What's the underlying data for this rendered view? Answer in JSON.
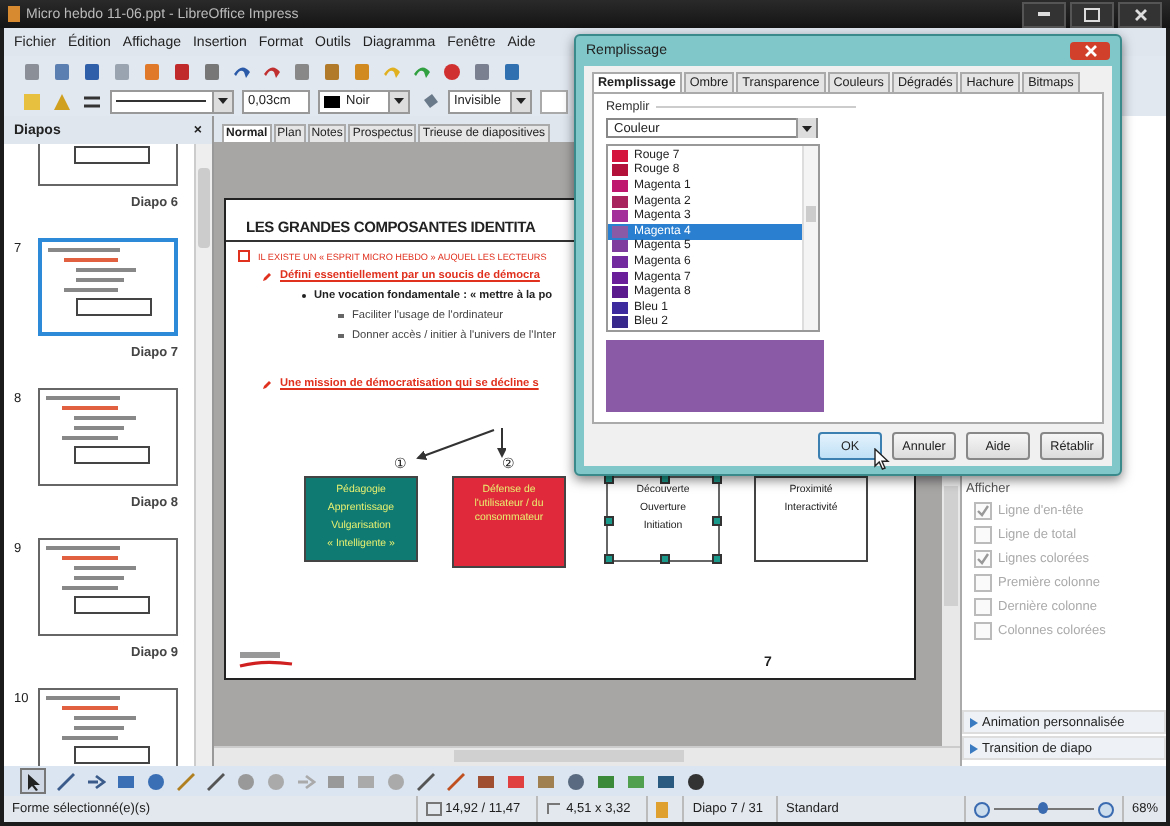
{
  "window": {
    "title": "Micro hebdo 11-06.ppt - LibreOffice Impress"
  },
  "menu": [
    "Fichier",
    "Édition",
    "Affichage",
    "Insertion",
    "Format",
    "Outils",
    "Diagramma",
    "Fenêtre",
    "Aide"
  ],
  "line_toolbar": {
    "line_width": "0,03cm",
    "line_color": "Noir",
    "area_style": "Invisible"
  },
  "slides_panel": {
    "title": "Diapos",
    "close": "×",
    "slides": [
      {
        "label": "Diapo 6",
        "selected": false
      },
      {
        "number": "7",
        "label": "Diapo 7",
        "selected": true
      },
      {
        "number": "8",
        "label": "Diapo 8",
        "selected": false
      },
      {
        "number": "9",
        "label": "Diapo 9",
        "selected": false
      },
      {
        "number": "10",
        "selected": false
      }
    ]
  },
  "view_tabs": [
    {
      "label": "Normal",
      "selected": true
    },
    {
      "label": "Plan",
      "selected": false
    },
    {
      "label": "Notes",
      "selected": false
    },
    {
      "label": "Prospectus",
      "selected": false
    },
    {
      "label": "Trieuse de diapositives",
      "selected": false
    }
  ],
  "slide": {
    "title": "LES GRANDES COMPOSANTES IDENTITA",
    "lines": [
      {
        "kind": "heading",
        "text": "IL EXISTE UN « ESPRIT MICRO HEBDO » AUQUEL LES LECTEURS"
      },
      {
        "kind": "link",
        "text": "Défini essentiellement par un soucis de démocra"
      },
      {
        "kind": "bullet",
        "text": "Une vocation fondamentale : « mettre à la po"
      },
      {
        "kind": "sub",
        "text": "Faciliter l'usage de l'ordinateur"
      },
      {
        "kind": "sub",
        "text": "Donner accès / initier à l'univers de l'Inter"
      },
      {
        "kind": "link",
        "text": "Une mission de démocratisation qui se décline s"
      }
    ],
    "markers": [
      "①",
      "②"
    ],
    "boxes": [
      {
        "lines": [
          "Pédagogie",
          "Apprentissage",
          "Vulgarisation",
          "« Intelligente »"
        ],
        "color": "#0f7a72",
        "selected": false
      },
      {
        "lines": [
          "Défense de",
          "l'utilisateur / du",
          "consommateur"
        ],
        "color": "#e02a3c",
        "selected": false
      },
      {
        "lines": [
          "Découverte",
          "Ouverture",
          "Initiation"
        ],
        "color": "#ffffff",
        "selected": true
      },
      {
        "lines": [
          "Proximité",
          "Interactivité"
        ],
        "color": "#ffffff",
        "selected": false
      }
    ],
    "page_number": "7"
  },
  "task_panel": {
    "section": "Afficher",
    "options": [
      {
        "label": "Ligne d'en-tête",
        "checked": true,
        "disabled": true
      },
      {
        "label": "Ligne de total",
        "checked": false,
        "disabled": true
      },
      {
        "label": "Lignes colorées",
        "checked": true,
        "disabled": true
      },
      {
        "label": "Première colonne",
        "checked": false,
        "disabled": true
      },
      {
        "label": "Dernière colonne",
        "checked": false,
        "disabled": true
      },
      {
        "label": "Colonnes colorées",
        "checked": false,
        "disabled": true
      }
    ],
    "sections": [
      "Animation personnalisée",
      "Transition de diapo"
    ]
  },
  "dialog": {
    "title": "Remplissage",
    "tabs": [
      {
        "label": "Remplissage",
        "selected": true
      },
      {
        "label": "Ombre",
        "selected": false
      },
      {
        "label": "Transparence",
        "selected": false
      },
      {
        "label": "Couleurs",
        "selected": false
      },
      {
        "label": "Dégradés",
        "selected": false
      },
      {
        "label": "Hachure",
        "selected": false
      },
      {
        "label": "Bitmaps",
        "selected": false
      }
    ],
    "group": "Remplir",
    "fill_type": "Couleur",
    "colors": [
      {
        "name": "Rouge 7",
        "color": "#d4143c",
        "selected": false
      },
      {
        "name": "Rouge 8",
        "color": "#b3103a",
        "selected": false
      },
      {
        "name": "Magenta 1",
        "color": "#c0176e",
        "selected": false
      },
      {
        "name": "Magenta 2",
        "color": "#a8245e",
        "selected": false
      },
      {
        "name": "Magenta 3",
        "color": "#a3309a",
        "selected": false
      },
      {
        "name": "Magenta 4",
        "color": "#8b5aa6",
        "selected": true
      },
      {
        "name": "Magenta 5",
        "color": "#7d3c9e",
        "selected": false
      },
      {
        "name": "Magenta 6",
        "color": "#732a9e",
        "selected": false
      },
      {
        "name": "Magenta 7",
        "color": "#6a1e9a",
        "selected": false
      },
      {
        "name": "Magenta 8",
        "color": "#5c1a8f",
        "selected": false
      },
      {
        "name": "Bleu 1",
        "color": "#3c2a9e",
        "selected": false
      },
      {
        "name": "Bleu 2",
        "color": "#38288c",
        "selected": false
      }
    ],
    "buttons": [
      "OK",
      "Annuler",
      "Aide",
      "Rétablir"
    ]
  },
  "status_bar": {
    "message": "Forme sélectionné(e)(s)",
    "position": "14,92 / 11,47",
    "size": "4,51 x 3,32",
    "slide": "Diapo 7 / 31",
    "layout": "Standard",
    "zoom": {
      "level": 0.45
    },
    "zoom_reading": "68%"
  }
}
